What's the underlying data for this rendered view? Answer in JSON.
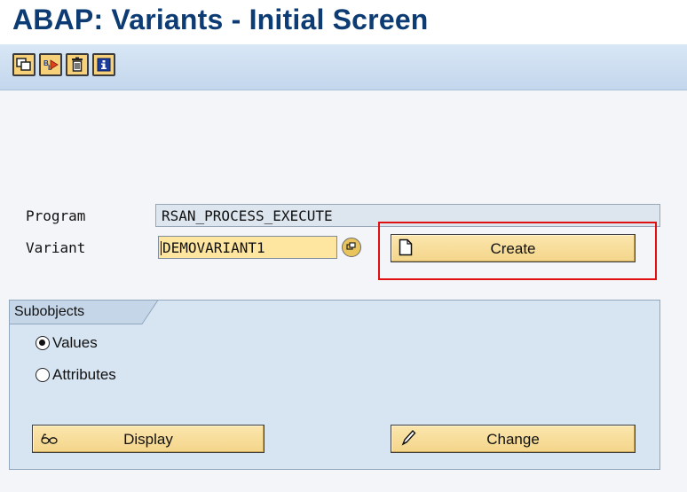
{
  "window": {
    "title": "ABAP: Variants - Initial Screen"
  },
  "toolbar": {
    "buttons": [
      {
        "name": "copy-icon"
      },
      {
        "name": "rename-icon"
      },
      {
        "name": "delete-icon"
      },
      {
        "name": "info-icon"
      }
    ]
  },
  "form": {
    "program_label": "Program",
    "program_value": "RSAN_PROCESS_EXECUTE",
    "variant_label": "Variant",
    "variant_value": "DEMOVARIANT1",
    "create_label": "Create"
  },
  "subobjects": {
    "title": "Subobjects",
    "options": [
      {
        "label": "Values",
        "selected": true
      },
      {
        "label": "Attributes",
        "selected": false
      }
    ],
    "display_label": "Display",
    "change_label": "Change"
  },
  "colors": {
    "title": "#0d3b73",
    "toolbar_bg": "#d1e1f2",
    "input_bg": "#ffe6a0",
    "button_bg": "#f7d98f",
    "highlight": "#e01010",
    "group_bg": "#d7e4f1"
  }
}
